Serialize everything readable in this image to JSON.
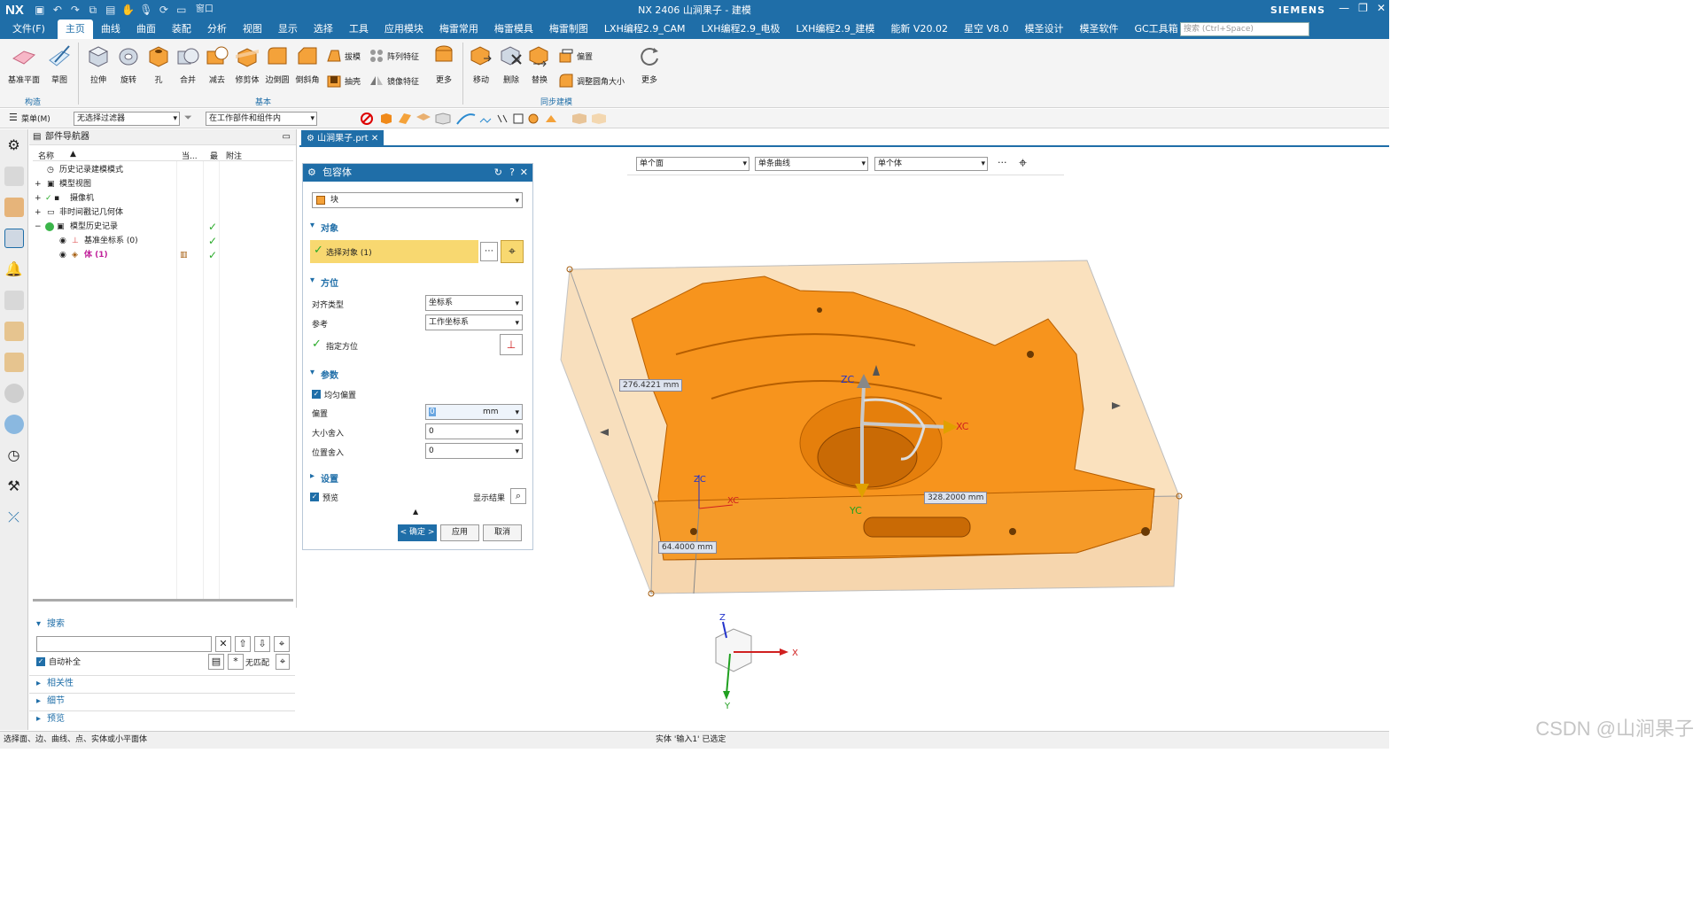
{
  "app": {
    "logo": "NX",
    "title": "NX 2406 山涧果子 - 建模",
    "brand": "SIEMENS"
  },
  "menu": {
    "file": "文件(F)",
    "tabs": [
      "主页",
      "曲线",
      "曲面",
      "装配",
      "分析",
      "视图",
      "显示",
      "选择",
      "工具",
      "应用模块",
      "梅雷常用",
      "梅雷模具",
      "梅雷制图",
      "LXH编程2.9_CAM",
      "LXH编程2.9_电极",
      "LXH编程2.9_建模",
      "能新 V20.02",
      "星空 V8.0",
      "模圣设计",
      "模圣软件",
      "GC工具箱"
    ],
    "search_placeholder": "搜索 (Ctrl+Space)",
    "window_menu": "窗口"
  },
  "ribbon": {
    "construct": {
      "datum_plane": "基准平面",
      "sketch": "草图",
      "group": "构造"
    },
    "basic": {
      "extrude": "拉伸",
      "revolve": "旋转",
      "hole": "孔",
      "unite": "合并",
      "subtract": "减去",
      "trim_body": "修剪体",
      "edge_blend": "边倒圆",
      "chamfer": "倒斜角",
      "draft": "拔模",
      "shell": "抽壳",
      "pattern_feature": "阵列特征",
      "mirror_feature": "镜像特征",
      "more": "更多",
      "group": "基本"
    },
    "sync": {
      "move": "移动",
      "delete": "删除",
      "replace": "替换",
      "offset": "偏置",
      "resize_blend": "调整圆角大小",
      "more": "更多",
      "group": "同步建模"
    }
  },
  "selection_bar": {
    "menu": "菜单(M)",
    "filter": "无选择过滤器",
    "scope": "在工作部件和组件内"
  },
  "navigator": {
    "title": "部件导航器",
    "columns": [
      "名称",
      "当...",
      "最",
      "附注"
    ],
    "nodes": [
      {
        "label": "历史记录建模模式",
        "check": ""
      },
      {
        "label": "模型视图",
        "check": ""
      },
      {
        "label": "摄像机",
        "check": ""
      },
      {
        "label": "非时间戳记几何体",
        "check": ""
      },
      {
        "label": "模型历史记录",
        "check": "✓"
      },
      {
        "label": "基准坐标系 (0)",
        "check": "✓"
      },
      {
        "label": "体 (1)",
        "check": "✓"
      }
    ]
  },
  "search_panel": {
    "title": "搜索",
    "auto_complete": "自动补全",
    "no_match": "无匹配",
    "sections": [
      "相关性",
      "细节",
      "预览"
    ]
  },
  "doc_tab": "山涧果子.prt",
  "dialog": {
    "title": "包容体",
    "type_value": "块",
    "sec_object": "对象",
    "select_object": "选择对象 (1)",
    "sec_orient": "方位",
    "align_type_label": "对齐类型",
    "align_type_value": "坐标系",
    "reference_label": "参考",
    "reference_value": "工作坐标系",
    "specify_orient": "指定方位",
    "sec_params": "参数",
    "uniform_offset": "均匀偏置",
    "offset_label": "偏置",
    "offset_value": "0",
    "offset_unit": "mm",
    "size_round_label": "大小舍入",
    "size_round_value": "0",
    "pos_round_label": "位置舍入",
    "pos_round_value": "0",
    "sec_settings": "设置",
    "preview": "预览",
    "show_result": "显示结果",
    "ok": "< 确定 >",
    "apply": "应用",
    "cancel": "取消"
  },
  "view_toolbar": {
    "face": "单个面",
    "curve": "单条曲线",
    "body": "单个体"
  },
  "viewport": {
    "dim1": "276.4221 mm",
    "dim2": "328.2000 mm",
    "dim3": "64.4000 mm",
    "axes": {
      "zc": "ZC",
      "xc": "XC",
      "yc": "YC",
      "z": "Z",
      "x": "X",
      "y": "Y"
    }
  },
  "colors": {
    "brand": "#1f6ea8",
    "part": "#f39a1e",
    "box": "#f4c07a"
  },
  "status": {
    "left": "选择面、边、曲线、点、实体或小平面体",
    "center": "实体 '输入1' 已选定"
  },
  "watermark": "CSDN @山涧果子"
}
